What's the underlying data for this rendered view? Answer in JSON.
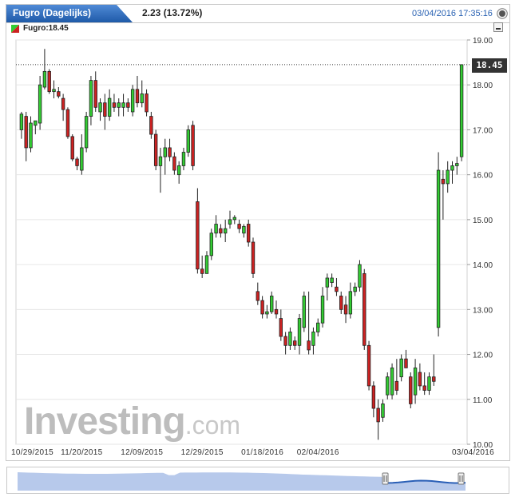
{
  "header": {
    "title": "Fugro (Dagelijks)",
    "change": "2.23 (13.72%)",
    "timestamp": "03/04/2016 17:35:16",
    "close_icon": "close-circle-icon"
  },
  "legend": {
    "label": "Fugro:18.45",
    "collapse_icon": "minus-icon"
  },
  "price_tag": "18.45",
  "watermark": {
    "brand": "Investing",
    "suffix": ".com"
  },
  "colors": {
    "up": "#33cc33",
    "down": "#cc2222",
    "title_bg": "#2f6db5",
    "grid": "#e6e6e6",
    "navigator_fill": "#aabfe8"
  },
  "chart_data": {
    "type": "candlestick",
    "title": "Fugro (Dagelijks)",
    "last_value": 18.45,
    "ylim": [
      10.0,
      19.0
    ],
    "y_ticks": [
      "10.00",
      "11.00",
      "12.00",
      "13.00",
      "14.00",
      "15.00",
      "16.00",
      "17.00",
      "18.00",
      "19.00"
    ],
    "x_tick_labels": [
      "10/29/2015",
      "11/20/2015",
      "12/09/2015",
      "12/29/2015",
      "01/18/2016",
      "02/04/2016",
      "03/04/2016"
    ],
    "grid": true,
    "series": [
      {
        "name": "Fugro",
        "ohlc": [
          [
            17.0,
            17.4,
            16.8,
            17.35
          ],
          [
            17.3,
            17.4,
            16.3,
            16.6
          ],
          [
            16.6,
            17.3,
            16.5,
            17.15
          ],
          [
            17.1,
            17.2,
            16.9,
            17.2
          ],
          [
            17.15,
            18.2,
            17.0,
            18.0
          ],
          [
            17.95,
            18.8,
            17.9,
            18.3
          ],
          [
            18.3,
            18.35,
            17.8,
            17.85
          ],
          [
            17.85,
            18.1,
            17.7,
            17.9
          ],
          [
            17.85,
            17.95,
            17.7,
            17.75
          ],
          [
            17.7,
            17.8,
            17.2,
            17.45
          ],
          [
            17.45,
            17.5,
            16.8,
            16.85
          ],
          [
            16.85,
            16.9,
            16.3,
            16.35
          ],
          [
            16.35,
            16.4,
            16.1,
            16.2
          ],
          [
            16.1,
            16.9,
            16.0,
            16.6
          ],
          [
            16.6,
            17.4,
            16.5,
            17.3
          ],
          [
            17.3,
            18.2,
            17.1,
            18.1
          ],
          [
            18.1,
            18.3,
            17.4,
            17.5
          ],
          [
            17.4,
            17.7,
            17.2,
            17.6
          ],
          [
            17.6,
            17.8,
            17.0,
            17.3
          ],
          [
            17.3,
            17.9,
            17.2,
            17.7
          ],
          [
            17.6,
            17.8,
            17.4,
            17.5
          ],
          [
            17.5,
            17.7,
            17.3,
            17.6
          ],
          [
            17.5,
            17.8,
            17.3,
            17.6
          ],
          [
            17.6,
            17.7,
            17.4,
            17.5
          ],
          [
            17.4,
            18.0,
            17.3,
            17.9
          ],
          [
            17.9,
            18.2,
            17.5,
            17.6
          ],
          [
            17.6,
            18.1,
            17.5,
            17.8
          ],
          [
            17.8,
            17.9,
            17.3,
            17.4
          ],
          [
            17.3,
            17.4,
            16.8,
            16.9
          ],
          [
            16.9,
            17.0,
            16.1,
            16.2
          ],
          [
            16.2,
            16.6,
            15.6,
            16.4
          ],
          [
            16.4,
            16.8,
            16.0,
            16.6
          ],
          [
            16.6,
            16.8,
            16.3,
            16.4
          ],
          [
            16.4,
            16.5,
            16.0,
            16.1
          ],
          [
            16.0,
            16.3,
            15.8,
            16.2
          ],
          [
            16.2,
            16.6,
            16.1,
            16.5
          ],
          [
            16.5,
            17.1,
            16.4,
            17.0
          ],
          [
            17.1,
            17.2,
            16.1,
            16.2
          ],
          [
            15.4,
            15.7,
            13.8,
            13.9
          ],
          [
            13.9,
            14.2,
            13.7,
            13.8
          ],
          [
            13.8,
            14.3,
            13.8,
            14.2
          ],
          [
            14.2,
            14.8,
            14.1,
            14.7
          ],
          [
            14.7,
            15.1,
            14.6,
            14.9
          ],
          [
            14.8,
            14.9,
            14.6,
            14.7
          ],
          [
            14.7,
            15.0,
            14.5,
            14.8
          ],
          [
            14.9,
            15.2,
            14.8,
            15.0
          ],
          [
            15.0,
            15.1,
            14.9,
            15.05
          ],
          [
            14.9,
            15.0,
            14.7,
            14.8
          ],
          [
            14.7,
            14.9,
            14.6,
            14.85
          ],
          [
            14.9,
            15.0,
            14.4,
            14.5
          ],
          [
            14.5,
            14.6,
            13.7,
            13.8
          ],
          [
            13.4,
            13.6,
            13.1,
            13.2
          ],
          [
            13.2,
            13.3,
            12.8,
            12.9
          ],
          [
            12.9,
            13.1,
            12.8,
            12.95
          ],
          [
            12.95,
            13.4,
            12.9,
            13.3
          ],
          [
            13.0,
            13.2,
            12.8,
            12.9
          ],
          [
            12.8,
            13.0,
            12.3,
            12.4
          ],
          [
            12.4,
            12.5,
            12.0,
            12.2
          ],
          [
            12.2,
            12.6,
            12.1,
            12.5
          ],
          [
            12.3,
            12.4,
            12.1,
            12.2
          ],
          [
            12.2,
            12.9,
            12.0,
            12.8
          ],
          [
            12.6,
            13.4,
            12.5,
            13.3
          ],
          [
            12.3,
            13.4,
            12.0,
            12.1
          ],
          [
            12.2,
            12.6,
            12.0,
            12.5
          ],
          [
            12.5,
            12.8,
            12.4,
            12.7
          ],
          [
            12.7,
            13.5,
            12.6,
            13.3
          ],
          [
            13.5,
            13.8,
            13.2,
            13.7
          ],
          [
            13.6,
            13.8,
            13.5,
            13.7
          ],
          [
            13.5,
            13.7,
            13.3,
            13.4
          ],
          [
            13.3,
            13.4,
            12.9,
            13.0
          ],
          [
            13.1,
            13.3,
            12.7,
            12.9
          ],
          [
            12.9,
            13.6,
            12.8,
            13.4
          ],
          [
            13.4,
            13.6,
            13.3,
            13.5
          ],
          [
            13.5,
            14.1,
            13.4,
            14.0
          ],
          [
            13.8,
            13.9,
            12.1,
            12.2
          ],
          [
            12.2,
            12.3,
            11.2,
            11.3
          ],
          [
            11.3,
            11.4,
            10.6,
            10.8
          ],
          [
            10.8,
            11.0,
            10.1,
            10.5
          ],
          [
            10.6,
            11.0,
            10.5,
            10.9
          ],
          [
            11.1,
            11.6,
            11.0,
            11.5
          ],
          [
            11.1,
            11.8,
            11.0,
            11.7
          ],
          [
            11.4,
            11.9,
            11.1,
            11.2
          ],
          [
            11.5,
            12.0,
            11.4,
            11.9
          ],
          [
            11.9,
            12.1,
            11.8,
            11.7
          ],
          [
            11.5,
            11.6,
            10.8,
            10.9
          ],
          [
            11.1,
            11.9,
            10.9,
            11.7
          ],
          [
            11.6,
            11.8,
            11.2,
            11.3
          ],
          [
            11.3,
            11.6,
            11.1,
            11.2
          ],
          [
            11.2,
            11.6,
            11.1,
            11.5
          ],
          [
            11.5,
            12.0,
            11.3,
            11.4
          ],
          [
            12.6,
            16.5,
            12.4,
            16.1
          ],
          [
            15.9,
            16.1,
            15.0,
            15.8
          ],
          [
            15.8,
            16.3,
            15.6,
            16.1
          ],
          [
            16.1,
            16.3,
            15.8,
            16.2
          ],
          [
            16.2,
            16.4,
            16.0,
            16.25
          ],
          [
            16.4,
            18.45,
            16.3,
            18.45
          ]
        ]
      }
    ],
    "navigator": {
      "series_color": "#aabfe8",
      "selected_color": "#2a5fb6"
    }
  }
}
